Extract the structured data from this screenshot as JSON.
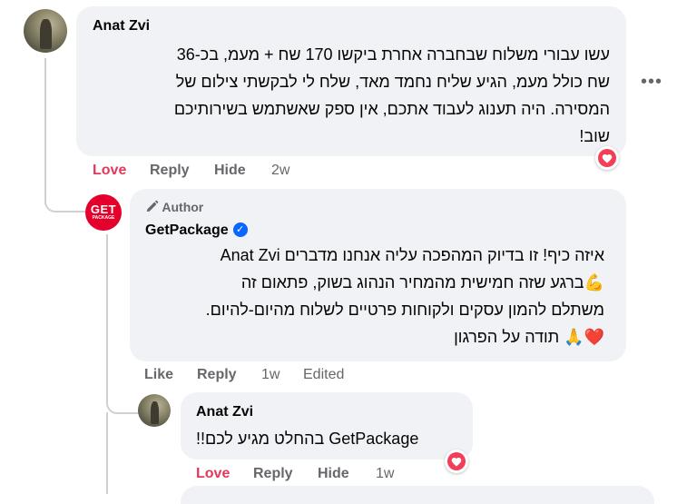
{
  "comment1": {
    "author": "Anat Zvi",
    "lines": [
      "עשו עבורי משלוח שבחברה אחרת ביקשו 170 שח + מעמ, בכ-36",
      "שח כולל מעמ, הגיע שליח נחמד מאד, שלח לי לבקשתי צילום של",
      "המסירה. היה תענוג לעבוד אתכם, אין ספק שאשתמש בשירותיכם",
      "שוב!"
    ],
    "actions": {
      "love": "Love",
      "reply": "Reply",
      "hide": "Hide",
      "time": "2w"
    },
    "more_label": "•••"
  },
  "reply1": {
    "badge": "Author",
    "author": "GetPackage",
    "avatar_text_top": "GET",
    "avatar_text_bottom": "PACKAGE",
    "lines": [
      "איזה כיף! זו בדיוק המהפכה עליה אנחנו מדברים Anat Zvi",
      "💪ברגע שזה חמישית מהמחיר הנהוג בשוק, פתאום זה",
      "משתלם להמון עסקים ולקוחות פרטיים לשלוח מהיום-להיום.",
      "❤️🙏 תודה על הפרגון"
    ],
    "actions": {
      "like": "Like",
      "reply": "Reply",
      "time": "1w",
      "edited": "Edited"
    }
  },
  "reply2": {
    "author": "Anat Zvi",
    "text": "GetPackage בהחלט מגיע לכם!!",
    "actions": {
      "love": "Love",
      "reply": "Reply",
      "hide": "Hide",
      "time": "1w"
    }
  },
  "colors": {
    "love": "#e4385a",
    "link_blue": "#0866ff",
    "brand_red": "#e4002b",
    "bubble": "#f0f2f5"
  }
}
